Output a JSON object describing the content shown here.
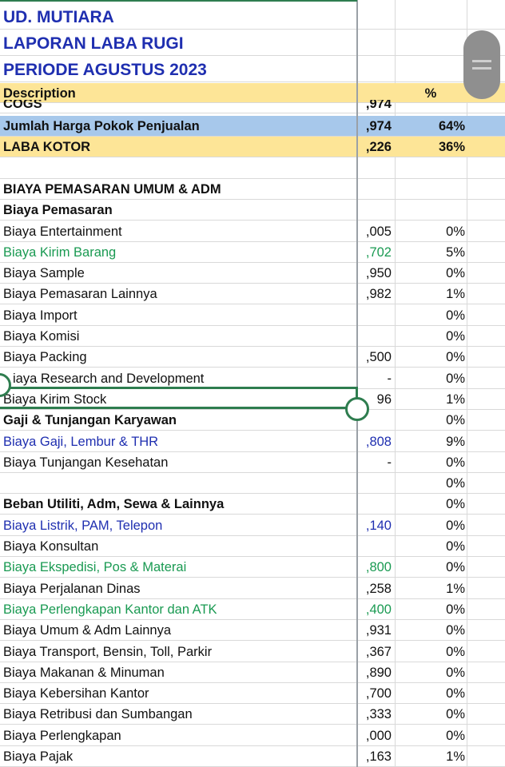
{
  "header": {
    "company": "UD. MUTIARA",
    "report": "LAPORAN LABA RUGI",
    "period": "PERIODE AGUSTUS 2023",
    "col_description": "Description",
    "col_percent": "%"
  },
  "rows": [
    {
      "desc": "COGS",
      "amt": ",974",
      "pct": "",
      "style": "partial"
    },
    {
      "desc": "Jumlah Harga Pokok Penjualan",
      "amt": ",974",
      "pct": "64%",
      "style": "blue-bg"
    },
    {
      "desc": "LABA KOTOR",
      "amt": ",226",
      "pct": "36%",
      "style": "yellow-bg"
    },
    {
      "desc": "",
      "amt": "",
      "pct": "",
      "style": "plain"
    },
    {
      "desc": "BIAYA PEMASARAN UMUM & ADM",
      "amt": "",
      "pct": "",
      "style": "bold"
    },
    {
      "desc": "Biaya Pemasaran",
      "amt": "",
      "pct": "",
      "style": "bold"
    },
    {
      "desc": "Biaya Entertainment",
      "amt": ",005",
      "pct": "0%",
      "style": "plain"
    },
    {
      "desc": "Biaya Kirim Barang",
      "amt": ",702",
      "pct": "5%",
      "style": "green"
    },
    {
      "desc": "Biaya Sample",
      "amt": ",950",
      "pct": "0%",
      "style": "plain"
    },
    {
      "desc": "Biaya Pemasaran Lainnya",
      "amt": ",982",
      "pct": "1%",
      "style": "plain"
    },
    {
      "desc": "Biaya Import",
      "amt": "",
      "pct": "0%",
      "style": "plain"
    },
    {
      "desc": "Biaya Komisi",
      "amt": "",
      "pct": "0%",
      "style": "plain"
    },
    {
      "desc": "Biaya Packing",
      "amt": ",500",
      "pct": "0%",
      "style": "plain"
    },
    {
      "desc": "iaya Research and Development",
      "amt": "-",
      "pct": "0%",
      "style": "plain"
    },
    {
      "desc": "Biaya Kirim Stock",
      "amt": "96",
      "pct": "1%",
      "style": "plain"
    },
    {
      "desc": "Gaji & Tunjangan Karyawan",
      "amt": "",
      "pct": "0%",
      "style": "bold"
    },
    {
      "desc": "Biaya Gaji, Lembur & THR",
      "amt": ",808",
      "pct": "9%",
      "style": "blue"
    },
    {
      "desc": "Biaya Tunjangan Kesehatan",
      "amt": "-",
      "pct": "0%",
      "style": "plain"
    },
    {
      "desc": "",
      "amt": "",
      "pct": "0%",
      "style": "plain"
    },
    {
      "desc": "Beban Utiliti, Adm, Sewa & Lainnya",
      "amt": "",
      "pct": "0%",
      "style": "bold"
    },
    {
      "desc": "Biaya Listrik, PAM, Telepon",
      "amt": ",140",
      "pct": "0%",
      "style": "blue"
    },
    {
      "desc": "Biaya Konsultan",
      "amt": "",
      "pct": "0%",
      "style": "plain"
    },
    {
      "desc": "Biaya Ekspedisi, Pos & Materai",
      "amt": ",800",
      "pct": "0%",
      "style": "green"
    },
    {
      "desc": "Biaya Perjalanan Dinas",
      "amt": ",258",
      "pct": "1%",
      "style": "plain"
    },
    {
      "desc": "Biaya Perlengkapan Kantor dan ATK",
      "amt": ",400",
      "pct": "0%",
      "style": "green"
    },
    {
      "desc": "Biaya Umum & Adm Lainnya",
      "amt": ",931",
      "pct": "0%",
      "style": "plain"
    },
    {
      "desc": "Biaya Transport, Bensin, Toll, Parkir",
      "amt": ",367",
      "pct": "0%",
      "style": "plain"
    },
    {
      "desc": "Biaya Makanan & Minuman",
      "amt": ",890",
      "pct": "0%",
      "style": "plain"
    },
    {
      "desc": "Biaya Kebersihan Kantor",
      "amt": ",700",
      "pct": "0%",
      "style": "plain"
    },
    {
      "desc": "Biaya Retribusi dan Sumbangan",
      "amt": ",333",
      "pct": "0%",
      "style": "plain"
    },
    {
      "desc": "Biaya Perlengkapan",
      "amt": ",000",
      "pct": "0%",
      "style": "plain"
    },
    {
      "desc": "Biaya Pajak",
      "amt": ",163",
      "pct": "1%",
      "style": "plain"
    }
  ],
  "colors": {
    "title_blue": "#1f2fb0",
    "header_yellow": "#fde597",
    "total_blue": "#a7c8eb",
    "text_green": "#1a9a52",
    "selection_green": "#2e7d4f"
  },
  "icons": {
    "scroll": "scroll-thumb-icon",
    "selection_handle": "selection-handle-icon"
  }
}
